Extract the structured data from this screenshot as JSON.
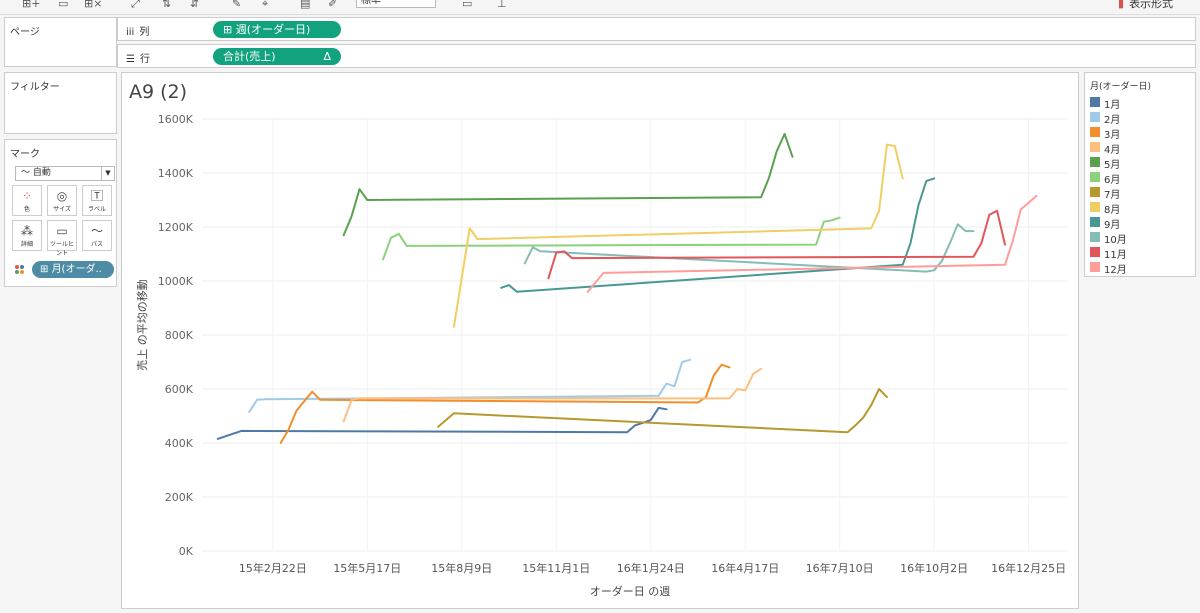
{
  "toolbar": {
    "fit_value": "標準",
    "show_me": "表示形式"
  },
  "shelves": {
    "pages_title": "ページ",
    "columns_label": "列",
    "columns_pill": "週(オーダー日)",
    "rows_label": "行",
    "rows_pill": "合計(売上)",
    "rows_pill_badge": "Δ"
  },
  "filters_title": "フィルター",
  "marks": {
    "title": "マーク",
    "type": "自動",
    "buttons": [
      {
        "label": "色"
      },
      {
        "label": "サイズ"
      },
      {
        "label": "ラベル"
      },
      {
        "label": "詳細"
      },
      {
        "label": "ツールヒント"
      },
      {
        "label": "パス"
      }
    ],
    "color_pill": "月(オーダ.."
  },
  "legend": {
    "title": "月(オーダー日)",
    "items": [
      {
        "label": "1月",
        "color": "#4e79a7"
      },
      {
        "label": "2月",
        "color": "#a0cbe8"
      },
      {
        "label": "3月",
        "color": "#f28e2b"
      },
      {
        "label": "4月",
        "color": "#ffbe7d"
      },
      {
        "label": "5月",
        "color": "#59a14f"
      },
      {
        "label": "6月",
        "color": "#8cd17d"
      },
      {
        "label": "7月",
        "color": "#b6992d"
      },
      {
        "label": "8月",
        "color": "#f1ce63"
      },
      {
        "label": "9月",
        "color": "#499894"
      },
      {
        "label": "10月",
        "color": "#86bcb6"
      },
      {
        "label": "11月",
        "color": "#e15759"
      },
      {
        "label": "12月",
        "color": "#ff9d9a"
      }
    ]
  },
  "sheet_title": "A9 (2)",
  "chart_data": {
    "type": "line",
    "title": "A9 (2)",
    "xlabel": "オーダー日 の週",
    "ylabel": "売上 の平均の移動",
    "ylim": [
      0,
      1600000
    ],
    "yticks": [
      {
        "value": 0,
        "label": "0K"
      },
      {
        "value": 200000,
        "label": "200K"
      },
      {
        "value": 400000,
        "label": "400K"
      },
      {
        "value": 600000,
        "label": "600K"
      },
      {
        "value": 800000,
        "label": "800K"
      },
      {
        "value": 1000000,
        "label": "1000K"
      },
      {
        "value": 1200000,
        "label": "1200K"
      },
      {
        "value": 1400000,
        "label": "1400K"
      },
      {
        "value": 1600000,
        "label": "1600K"
      }
    ],
    "xlim": [
      "2014-12-21",
      "2017-01-29"
    ],
    "xticks": [
      {
        "value": "2015-02-22",
        "label": "15年2月22日"
      },
      {
        "value": "2015-05-17",
        "label": "15年5月17日"
      },
      {
        "value": "2015-08-09",
        "label": "15年8月9日"
      },
      {
        "value": "2015-11-01",
        "label": "15年11月1日"
      },
      {
        "value": "2016-01-24",
        "label": "16年1月24日"
      },
      {
        "value": "2016-04-17",
        "label": "16年4月17日"
      },
      {
        "value": "2016-07-10",
        "label": "16年7月10日"
      },
      {
        "value": "2016-10-02",
        "label": "16年10月2日"
      },
      {
        "value": "2016-12-25",
        "label": "16年12月25日"
      }
    ],
    "series": [
      {
        "name": "1月",
        "color": "#4e79a7",
        "points": [
          [
            "2015-01-04",
            415000
          ],
          [
            "2015-01-18",
            435000
          ],
          [
            "2015-01-25",
            445000
          ],
          [
            "2016-01-03",
            440000
          ],
          [
            "2016-01-10",
            465000
          ],
          [
            "2016-01-17",
            475000
          ],
          [
            "2016-01-24",
            485000
          ],
          [
            "2016-01-31",
            530000
          ],
          [
            "2016-02-07",
            525000
          ]
        ]
      },
      {
        "name": "2月",
        "color": "#a0cbe8",
        "points": [
          [
            "2015-02-01",
            515000
          ],
          [
            "2015-02-08",
            560000
          ],
          [
            "2015-02-15",
            562000
          ],
          [
            "2016-01-31",
            575000
          ],
          [
            "2016-02-07",
            620000
          ],
          [
            "2016-02-14",
            610000
          ],
          [
            "2016-02-21",
            700000
          ],
          [
            "2016-02-28",
            708000
          ]
        ]
      },
      {
        "name": "3月",
        "color": "#f28e2b",
        "points": [
          [
            "2015-03-01",
            400000
          ],
          [
            "2015-03-08",
            450000
          ],
          [
            "2015-03-15",
            520000
          ],
          [
            "2015-03-29",
            590000
          ],
          [
            "2015-04-05",
            560000
          ],
          [
            "2016-03-06",
            550000
          ],
          [
            "2016-03-13",
            570000
          ],
          [
            "2016-03-20",
            650000
          ],
          [
            "2016-03-27",
            690000
          ],
          [
            "2016-04-03",
            680000
          ]
        ]
      },
      {
        "name": "4月",
        "color": "#ffbe7d",
        "points": [
          [
            "2015-04-26",
            480000
          ],
          [
            "2015-05-03",
            560000
          ],
          [
            "2015-05-10",
            565000
          ],
          [
            "2016-04-03",
            565000
          ],
          [
            "2016-04-10",
            600000
          ],
          [
            "2016-04-17",
            595000
          ],
          [
            "2016-04-24",
            655000
          ],
          [
            "2016-05-01",
            675000
          ]
        ]
      },
      {
        "name": "5月",
        "color": "#59a14f",
        "points": [
          [
            "2015-04-26",
            1170000
          ],
          [
            "2015-05-03",
            1240000
          ],
          [
            "2015-05-10",
            1340000
          ],
          [
            "2015-05-17",
            1300000
          ],
          [
            "2016-05-01",
            1310000
          ],
          [
            "2016-05-08",
            1380000
          ],
          [
            "2016-05-15",
            1480000
          ],
          [
            "2016-05-22",
            1545000
          ],
          [
            "2016-05-29",
            1460000
          ]
        ]
      },
      {
        "name": "6月",
        "color": "#8cd17d",
        "points": [
          [
            "2015-05-31",
            1080000
          ],
          [
            "2015-06-07",
            1160000
          ],
          [
            "2015-06-14",
            1175000
          ],
          [
            "2015-06-21",
            1130000
          ],
          [
            "2016-06-19",
            1135000
          ],
          [
            "2016-06-26",
            1220000
          ],
          [
            "2016-07-03",
            1225000
          ],
          [
            "2016-07-10",
            1235000
          ]
        ]
      },
      {
        "name": "7月",
        "color": "#b6992d",
        "points": [
          [
            "2015-07-19",
            460000
          ],
          [
            "2015-08-02",
            510000
          ],
          [
            "2016-07-17",
            440000
          ],
          [
            "2016-07-24",
            465000
          ],
          [
            "2016-07-31",
            495000
          ],
          [
            "2016-08-07",
            540000
          ],
          [
            "2016-08-14",
            600000
          ],
          [
            "2016-08-21",
            570000
          ]
        ]
      },
      {
        "name": "8月",
        "color": "#f1ce63",
        "points": [
          [
            "2015-08-02",
            830000
          ],
          [
            "2015-08-16",
            1195000
          ],
          [
            "2015-08-23",
            1155000
          ],
          [
            "2016-08-07",
            1195000
          ],
          [
            "2016-08-14",
            1260000
          ],
          [
            "2016-08-21",
            1505000
          ],
          [
            "2016-08-28",
            1500000
          ],
          [
            "2016-09-04",
            1380000
          ]
        ]
      },
      {
        "name": "9月",
        "color": "#499894",
        "points": [
          [
            "2015-09-13",
            975000
          ],
          [
            "2015-09-20",
            985000
          ],
          [
            "2015-09-27",
            960000
          ],
          [
            "2016-09-04",
            1060000
          ],
          [
            "2016-09-11",
            1140000
          ],
          [
            "2016-09-18",
            1280000
          ],
          [
            "2016-09-25",
            1370000
          ],
          [
            "2016-10-02",
            1380000
          ]
        ]
      },
      {
        "name": "10月",
        "color": "#86bcb6",
        "points": [
          [
            "2015-10-04",
            1065000
          ],
          [
            "2015-10-11",
            1125000
          ],
          [
            "2015-10-18",
            1110000
          ],
          [
            "2016-09-25",
            1035000
          ],
          [
            "2016-10-02",
            1040000
          ],
          [
            "2016-10-09",
            1075000
          ],
          [
            "2016-10-16",
            1140000
          ],
          [
            "2016-10-23",
            1210000
          ],
          [
            "2016-10-30",
            1185000
          ],
          [
            "2016-11-06",
            1185000
          ]
        ]
      },
      {
        "name": "11月",
        "color": "#e15759",
        "points": [
          [
            "2015-10-25",
            1010000
          ],
          [
            "2015-11-01",
            1105000
          ],
          [
            "2015-11-08",
            1110000
          ],
          [
            "2015-11-15",
            1085000
          ],
          [
            "2016-11-06",
            1090000
          ],
          [
            "2016-11-13",
            1140000
          ],
          [
            "2016-11-20",
            1245000
          ],
          [
            "2016-11-27",
            1260000
          ],
          [
            "2016-12-04",
            1135000
          ]
        ]
      },
      {
        "name": "12月",
        "color": "#ff9d9a",
        "points": [
          [
            "2015-11-29",
            960000
          ],
          [
            "2015-12-06",
            995000
          ],
          [
            "2015-12-13",
            1030000
          ],
          [
            "2016-12-04",
            1060000
          ],
          [
            "2016-12-11",
            1150000
          ],
          [
            "2016-12-18",
            1265000
          ],
          [
            "2016-12-25",
            1290000
          ],
          [
            "2017-01-01",
            1315000
          ]
        ]
      }
    ]
  }
}
